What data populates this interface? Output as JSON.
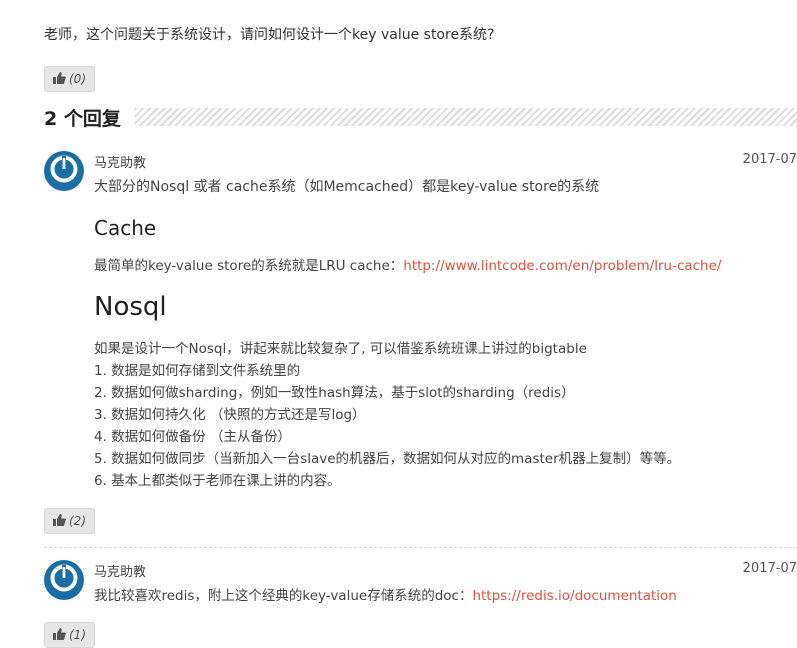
{
  "question": {
    "text": "老师，这个问题关于系统设计，请问如何设计一个key value store系统?",
    "likes": "(0)"
  },
  "replies_header": {
    "count": "2",
    "label": "个回复"
  },
  "replies": [
    {
      "author": "马克助教",
      "date": "2017-07",
      "intro": "大部分的Nosql 或者 cache系统（如Memcached）都是key-value store的系统",
      "cache_heading": "Cache",
      "cache_text": "最简单的key-value store的系统就是LRU cache：",
      "cache_link": "http://www.lintcode.com/en/problem/lru-cache/",
      "nosql_heading": "Nosql",
      "nosql_intro": "如果是设计一个Nosql，讲起来就比较复杂了, 可以借鉴系统班课上讲过的bigtable",
      "list": [
        "1. 数据是如何存储到文件系统里的",
        "2. 数据如何做sharding，例如一致性hash算法，基于slot的sharding（redis）",
        "3. 数据如何持久化 （快照的方式还是写log）",
        "4. 数据如何做备份 （主从备份）",
        "5. 数据如何做同步（当新加入一台slave的机器后，数据如何从对应的master机器上复制）等等。",
        "6. 基本上都类似于老师在课上讲的内容。"
      ],
      "likes": "(2)"
    },
    {
      "author": "马克助教",
      "date": "2017-07",
      "text": "我比较喜欢redis，附上这个经典的key-value存储系统的doc：",
      "link": "https://redis.io/documentation",
      "likes": "(1)"
    }
  ],
  "icons": {
    "like": "thumbs-up-icon",
    "avatar": "power-icon"
  },
  "colors": {
    "link": "#e0513d",
    "avatar": "#1a6ea8",
    "button_bg": "#e6e6e6"
  }
}
